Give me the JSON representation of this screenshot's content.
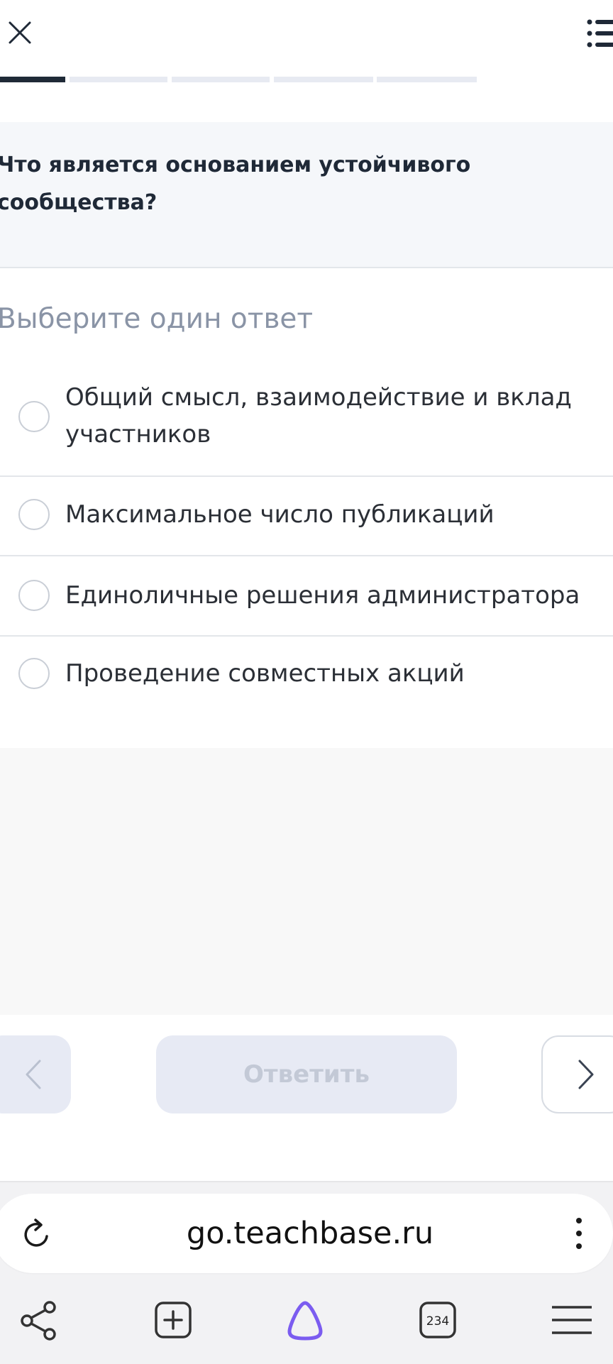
{
  "progress": {
    "total_segments": 5,
    "current_segment": 1
  },
  "question": {
    "text": "Что является основанием устойчивого сообщества?"
  },
  "hint": "Выберите один ответ",
  "options": [
    {
      "label": "Общий смысл, взаимодействие и вклад участников",
      "selected": false
    },
    {
      "label": "Максимальное число публикаций",
      "selected": false
    },
    {
      "label": "Единоличные решения администратора",
      "selected": false
    },
    {
      "label": "Проведение совместных акций",
      "selected": false
    }
  ],
  "controls": {
    "answer_label": "Ответить",
    "prev_icon": "chevron-left-icon",
    "next_icon": "chevron-right-icon"
  },
  "browser": {
    "url": "go.teachbase.ru",
    "tab_count": "234"
  },
  "colors": {
    "progress_active": "#1f2a37",
    "progress_inactive": "#e7eaf2",
    "question_bg": "#f5f7fa",
    "hint_text": "#8a94a6",
    "button_disabled_bg": "#e7eaf4",
    "button_disabled_text": "#c3c9d6",
    "assistant_accent": "#7b5cf0"
  }
}
